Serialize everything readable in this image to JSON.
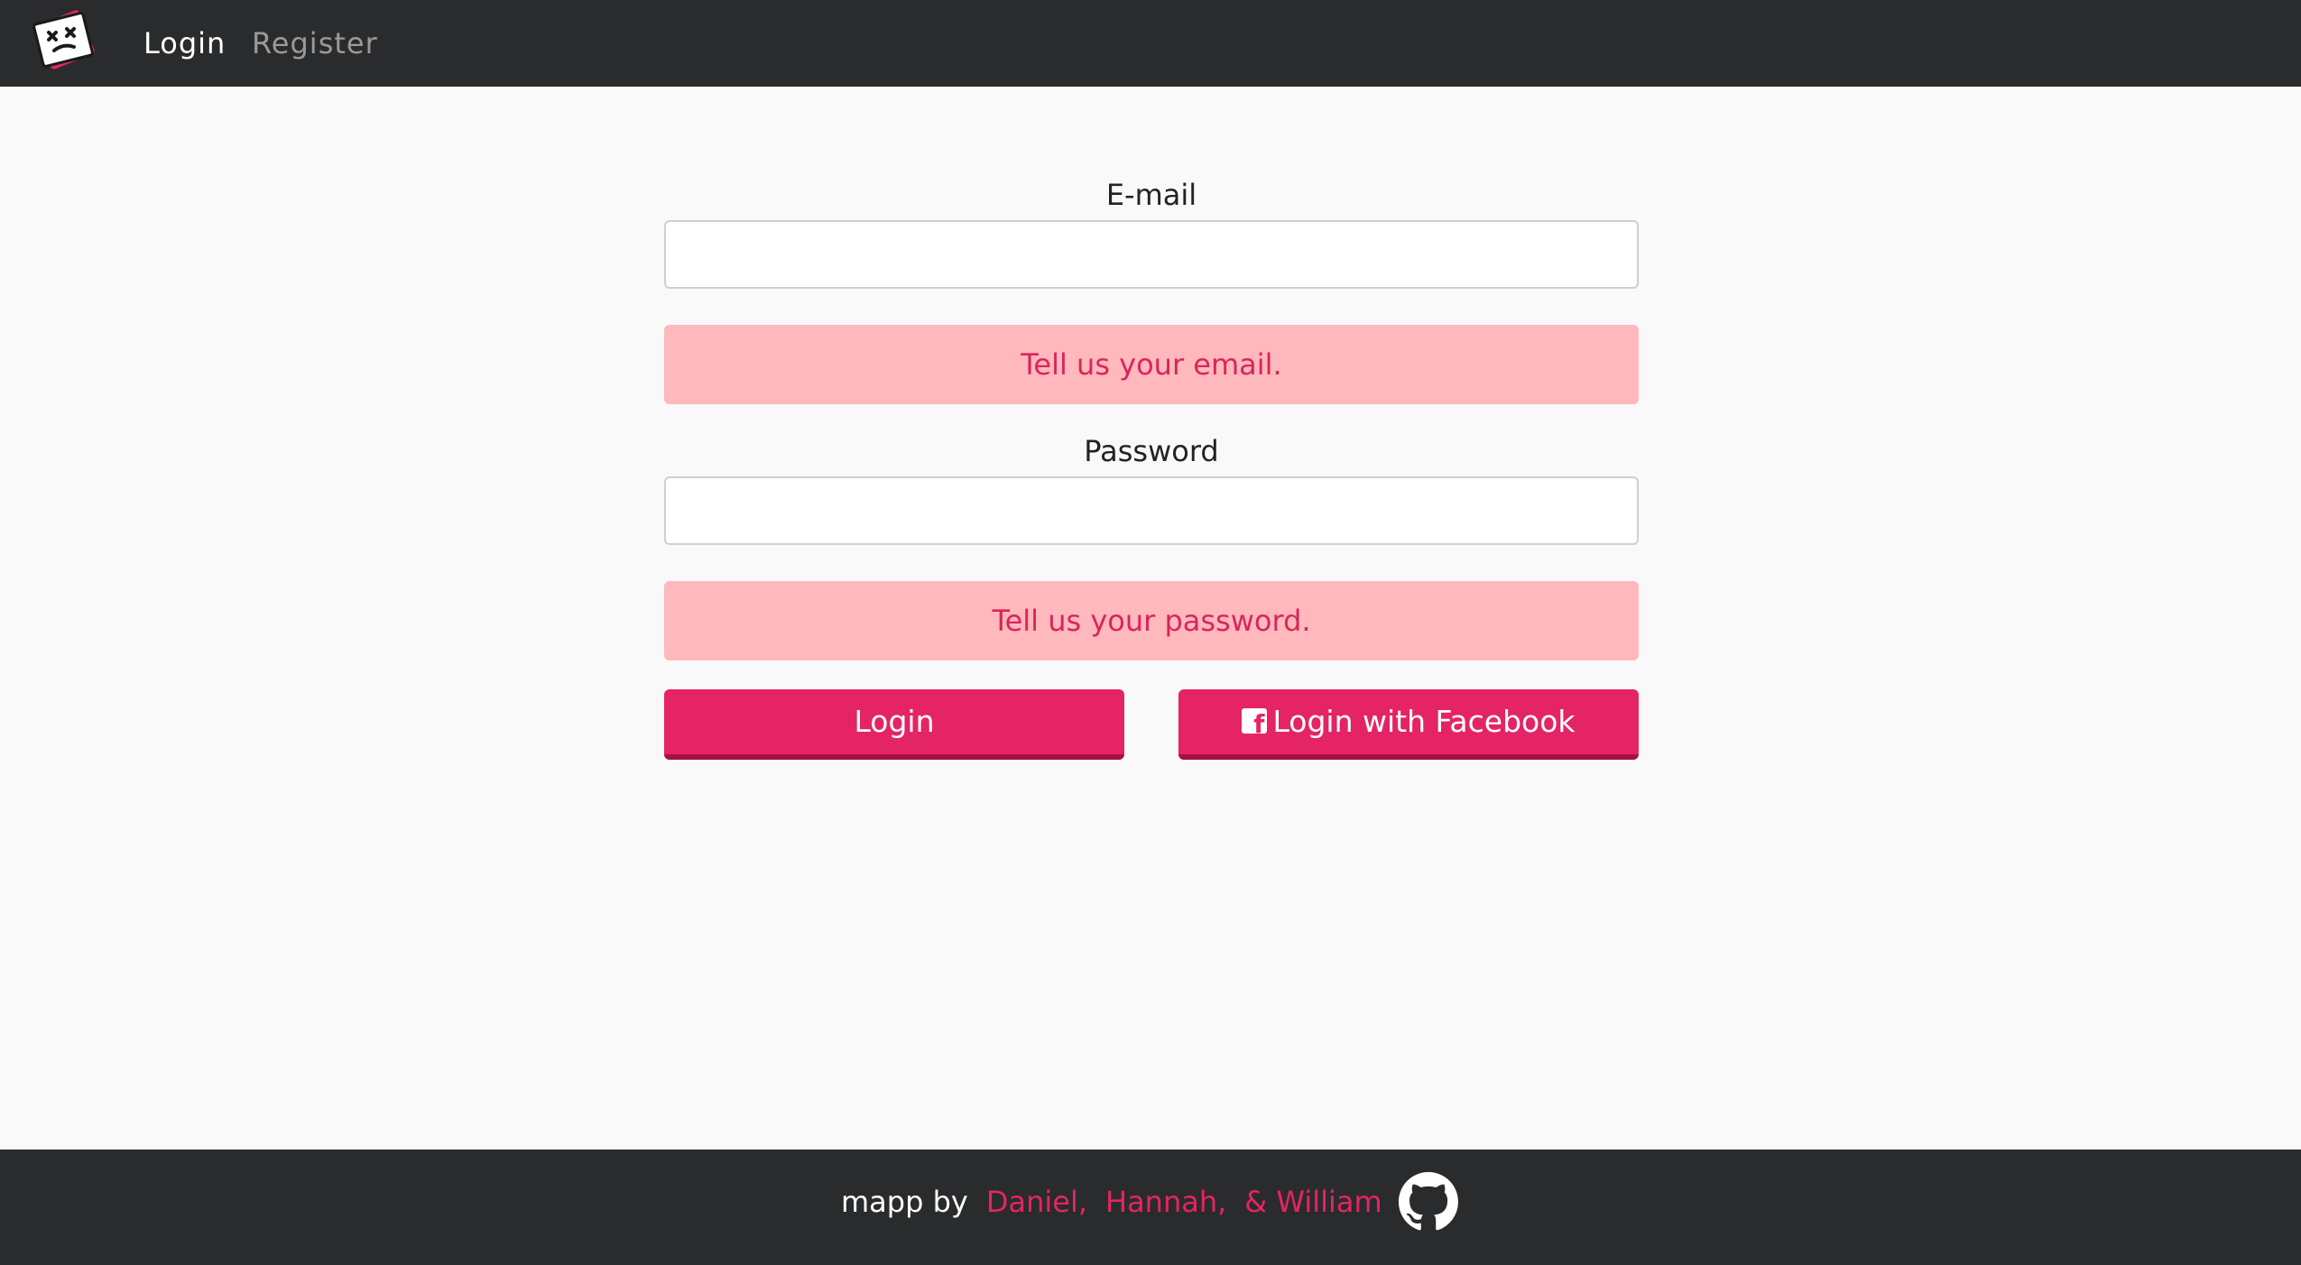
{
  "nav": {
    "logo_icon": "dead-face-logo-icon",
    "links": [
      {
        "label": "Login",
        "active": true
      },
      {
        "label": "Register",
        "active": false
      }
    ]
  },
  "form": {
    "email": {
      "label": "E-mail",
      "value": "",
      "placeholder": "",
      "error": "Tell us your email."
    },
    "password": {
      "label": "Password",
      "value": "",
      "placeholder": "",
      "error": "Tell us your password."
    },
    "login_button": "Login",
    "facebook_button": "Login with Facebook",
    "facebook_icon": "facebook-square-icon"
  },
  "footer": {
    "prefix": "mapp by",
    "authors": [
      "Daniel,",
      "Hannah,",
      "& William"
    ],
    "github_icon": "github-icon"
  },
  "colors": {
    "accent": "#e42464",
    "navbar_bg": "#2a2b2d",
    "error_bg": "#ffb8bb",
    "error_text": "#d9255c",
    "page_bg": "#f9f9f9"
  }
}
